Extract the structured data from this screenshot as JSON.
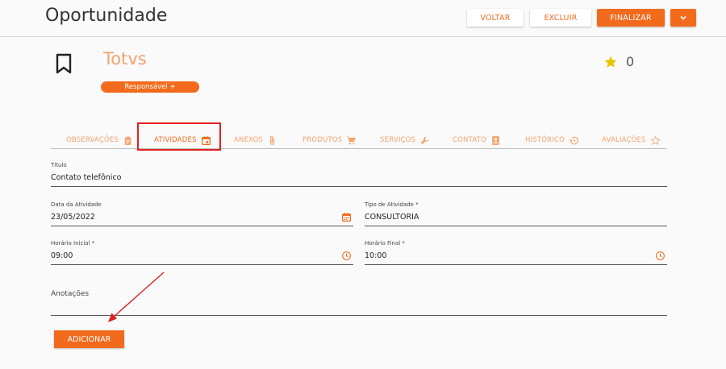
{
  "header": {
    "title": "Oportunidade",
    "buttons": {
      "back": "VOLTAR",
      "delete": "EXCLUIR",
      "finish": "FINALIZAR"
    }
  },
  "opportunity": {
    "company": "Totvs",
    "responsible_label": "Responsável +",
    "rating": "0"
  },
  "tabs": [
    {
      "label": "OBSERVAÇÕES",
      "icon": "clipboard-icon"
    },
    {
      "label": "ATIVIDADES",
      "icon": "calendar-icon"
    },
    {
      "label": "ANEXOS",
      "icon": "paperclip-icon"
    },
    {
      "label": "PRODUTOS",
      "icon": "cart-icon"
    },
    {
      "label": "SERVIÇOS",
      "icon": "wrench-icon"
    },
    {
      "label": "CONTATO",
      "icon": "contact-card-icon"
    },
    {
      "label": "HISTÓRICO",
      "icon": "history-icon"
    },
    {
      "label": "AVALIAÇÕES",
      "icon": "star-outline-icon"
    }
  ],
  "form": {
    "title": {
      "label": "Título",
      "value": "Contato telefônico"
    },
    "activity_date": {
      "label": "Data da Atividade",
      "value": "23/05/2022"
    },
    "activity_type": {
      "label": "Tipo de Atividade *",
      "value": "CONSULTORIA"
    },
    "start_time": {
      "label": "Horário Inicial *",
      "value": "09:00"
    },
    "end_time": {
      "label": "Horário Final *",
      "value": "10:00"
    },
    "notes": {
      "label": "Anotações",
      "value": ""
    },
    "add_button": "ADICIONAR"
  },
  "colors": {
    "accent": "#f26b1d",
    "accent_light": "#f4a36e",
    "annotation": "#e0201e",
    "star": "#e8c400"
  }
}
